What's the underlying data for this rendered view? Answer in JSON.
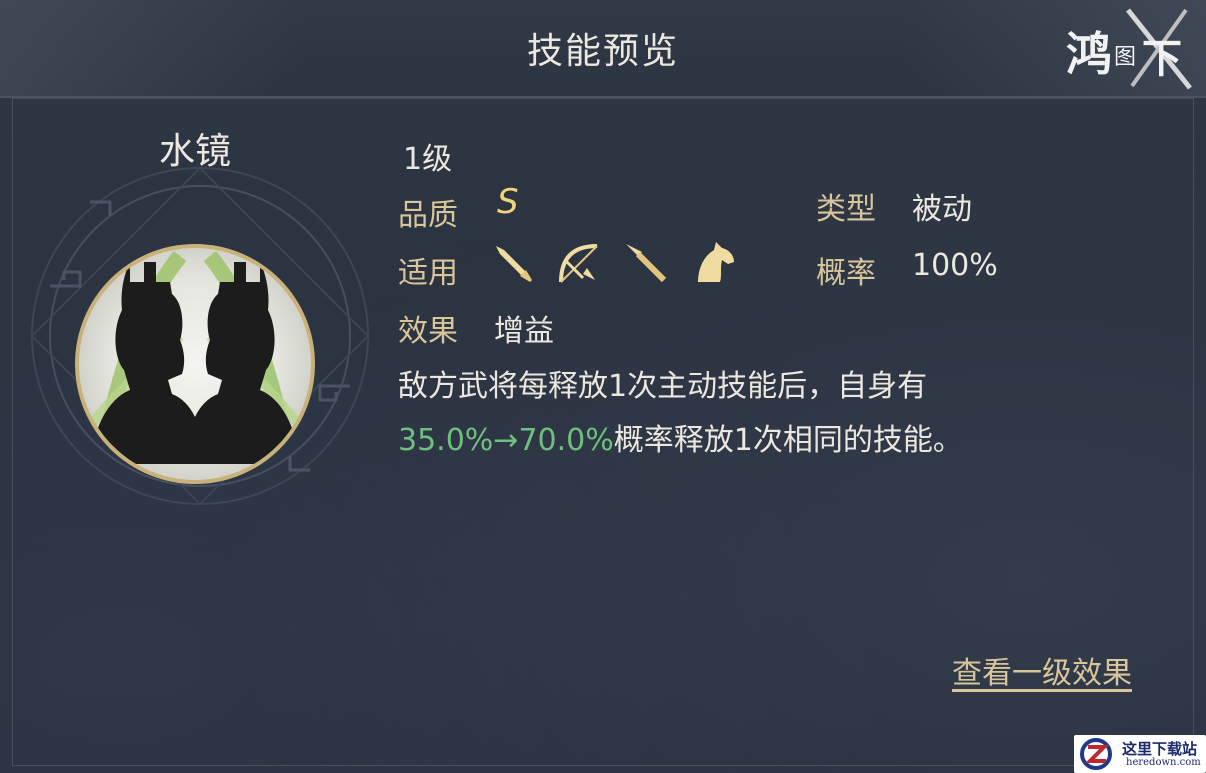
{
  "header": {
    "title": "技能预览"
  },
  "logo": {
    "text": "鸿图之下"
  },
  "skill": {
    "name": "水镜",
    "level": "1级",
    "quality_label": "品质",
    "quality_value": "S",
    "type_label": "类型",
    "type_value": "被动",
    "applies_label": "适用",
    "applies_icons": [
      "sword-icon",
      "bow-icon",
      "spear-icon",
      "horse-icon"
    ],
    "chance_label": "概率",
    "chance_value": "100%",
    "effect_label": "效果",
    "effect_value": "增益",
    "description_line1": "敌方武将每释放1次主动技能后，自身有",
    "description_highlight": "35.0%→70.0%",
    "description_line2": "概率释放1次相同的技能。"
  },
  "actions": {
    "view_level1": "查看一级效果"
  },
  "watermark": {
    "cn": "这里下载站",
    "en": "heredown.com"
  },
  "colors": {
    "background": "#2b3340",
    "label_gold": "#d9c59a",
    "quality_gold": "#f0d478",
    "highlight_green": "#6fbf7e",
    "text": "#ece8df"
  }
}
